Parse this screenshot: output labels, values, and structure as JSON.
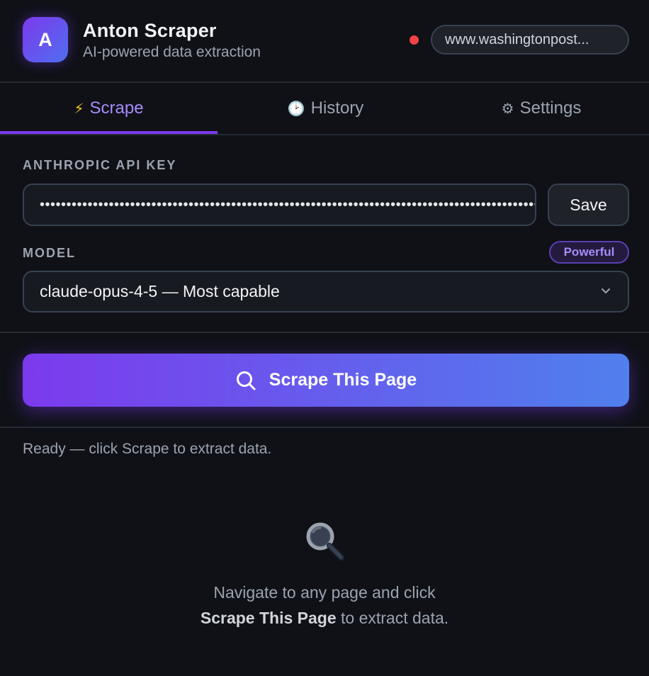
{
  "header": {
    "logo_letter": "A",
    "title": "Anton Scraper",
    "subtitle": "AI-powered data extraction",
    "status_color": "#ef4444",
    "url": "www.washingtonpost..."
  },
  "tabs": [
    {
      "icon": "⚡",
      "label": "Scrape",
      "active": true
    },
    {
      "icon": "🕑",
      "label": "History",
      "active": false
    },
    {
      "icon": "⚙",
      "label": "Settings",
      "active": false
    }
  ],
  "api_key": {
    "label": "ANTHROPIC API KEY",
    "value": "•••••••••••••••••••••••••••••••••••••••••••••••••••••••••••••••••••••••••••••••••••••••••••••••••",
    "save_label": "Save"
  },
  "model": {
    "label": "MODEL",
    "badge": "Powerful",
    "selected": "claude-opus-4-5 — Most capable"
  },
  "scrape_button": {
    "label": "Scrape This Page"
  },
  "status": "Ready — click Scrape to extract data.",
  "empty_state": {
    "line1": "Navigate to any page and click",
    "line2_bold": "Scrape This Page",
    "line2_rest": " to extract data."
  },
  "colors": {
    "accent": "#7c3aed",
    "accent_text": "#a78bfa",
    "gradient_end": "#4f80ed",
    "background": "#0f1117"
  }
}
